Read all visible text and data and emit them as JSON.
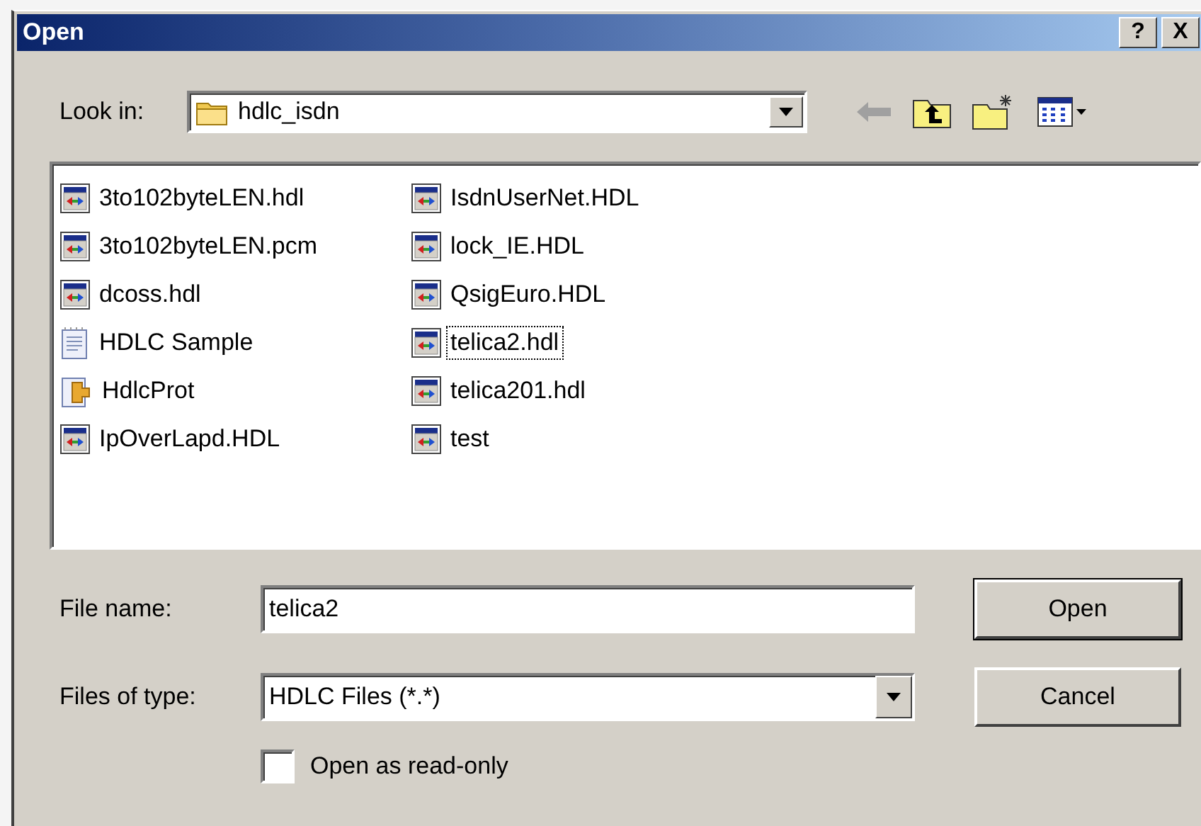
{
  "window": {
    "title": "Open",
    "buttons": [
      "?",
      "X"
    ]
  },
  "look_in": {
    "label": "Look in:",
    "value": "hdlc_isdn"
  },
  "files": [
    {
      "name": "3to102byteLEN.hdl",
      "kind": "hdl",
      "focused": false
    },
    {
      "name": "3to102byteLEN.pcm",
      "kind": "hdl",
      "focused": false
    },
    {
      "name": "dcoss.hdl",
      "kind": "hdl",
      "focused": false
    },
    {
      "name": "HDLC Sample",
      "kind": "text",
      "focused": false
    },
    {
      "name": "HdlcProt",
      "kind": "shortcut",
      "focused": false
    },
    {
      "name": "IpOverLapd.HDL",
      "kind": "hdl",
      "focused": false
    },
    {
      "name": "IsdnUserNet.HDL",
      "kind": "hdl",
      "focused": false
    },
    {
      "name": "lock_IE.HDL",
      "kind": "hdl",
      "focused": false
    },
    {
      "name": "QsigEuro.HDL",
      "kind": "hdl",
      "focused": false
    },
    {
      "name": "telica2.hdl",
      "kind": "hdl",
      "focused": true
    },
    {
      "name": "telica201.hdl",
      "kind": "hdl",
      "focused": false
    },
    {
      "name": "test",
      "kind": "hdl",
      "focused": false
    }
  ],
  "file_name": {
    "label": "File name:",
    "value": "telica2"
  },
  "file_type": {
    "label": "Files of type:",
    "value": "HDLC Files (*.*)"
  },
  "buttons": [
    {
      "label": "Open",
      "default": true
    },
    {
      "label": "Cancel",
      "default": false
    }
  ],
  "read_only": {
    "label": "Open as read-only",
    "checked": false
  }
}
